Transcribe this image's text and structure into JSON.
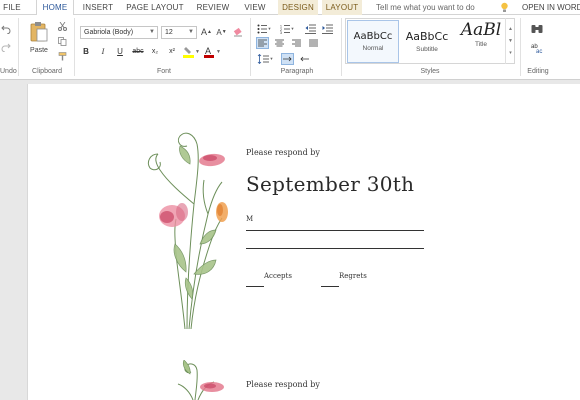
{
  "tabs": [
    {
      "label": "FILE"
    },
    {
      "label": "HOME"
    },
    {
      "label": "INSERT"
    },
    {
      "label": "PAGE LAYOUT"
    },
    {
      "label": "REVIEW"
    },
    {
      "label": "VIEW"
    },
    {
      "label": "DESIGN"
    },
    {
      "label": "LAYOUT"
    }
  ],
  "tell_me": "Tell me what you want to do",
  "open_in": "OPEN IN WORD",
  "ribbon": {
    "undo_label": "Undo",
    "clipboard": {
      "label": "Clipboard",
      "paste": "Paste"
    },
    "font": {
      "label": "Font",
      "name": "Gabriola (Body)",
      "size": "12",
      "bold": "B",
      "italic": "I",
      "underline": "U",
      "strike": "abc",
      "sub": "x₂",
      "sup": "x²"
    },
    "paragraph": {
      "label": "Paragraph"
    },
    "styles": {
      "label": "Styles",
      "items": [
        {
          "sample": "AaBbCc",
          "name": "Normal"
        },
        {
          "sample": "AaBbCc",
          "name": "Subtitle"
        },
        {
          "sample": "AaBl",
          "name": "Title"
        }
      ]
    },
    "editing": {
      "label": "Editing"
    }
  },
  "document": {
    "card1": {
      "respond": "Please respond by",
      "date": "September 30th",
      "m": "M",
      "accepts": "Accepts",
      "regrets": "Regrets"
    },
    "card2": {
      "respond": "Please respond by"
    }
  },
  "colors": {
    "accent": "#2b579a",
    "highlight": "#ffff00",
    "font_color": "#c00000"
  }
}
